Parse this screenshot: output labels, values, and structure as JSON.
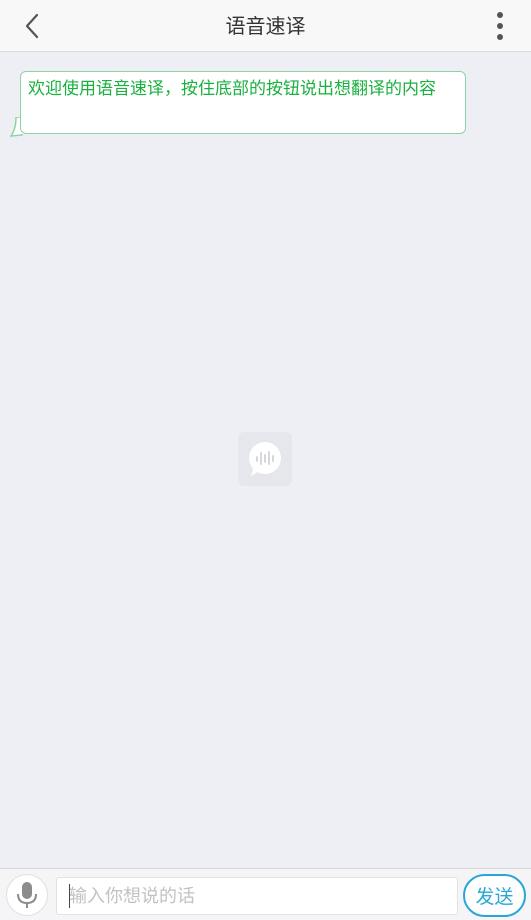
{
  "header": {
    "title": "语音速译",
    "back_icon": "chevron-left-icon",
    "more_icon": "more-vertical-icon"
  },
  "chat": {
    "messages": [
      {
        "text": "欢迎使用语音速译，按住底部的按钮说出想翻译的内容"
      }
    ],
    "center_icon": "voice-chat-logo-icon"
  },
  "input_bar": {
    "mic_icon": "microphone-icon",
    "placeholder": "输入你想说的话",
    "value": "",
    "send_label": "发送"
  },
  "colors": {
    "bubble_text": "#1ab040",
    "bubble_border": "#8ed3a4",
    "send_accent": "#2aa6d6",
    "background": "#eeeff5"
  }
}
